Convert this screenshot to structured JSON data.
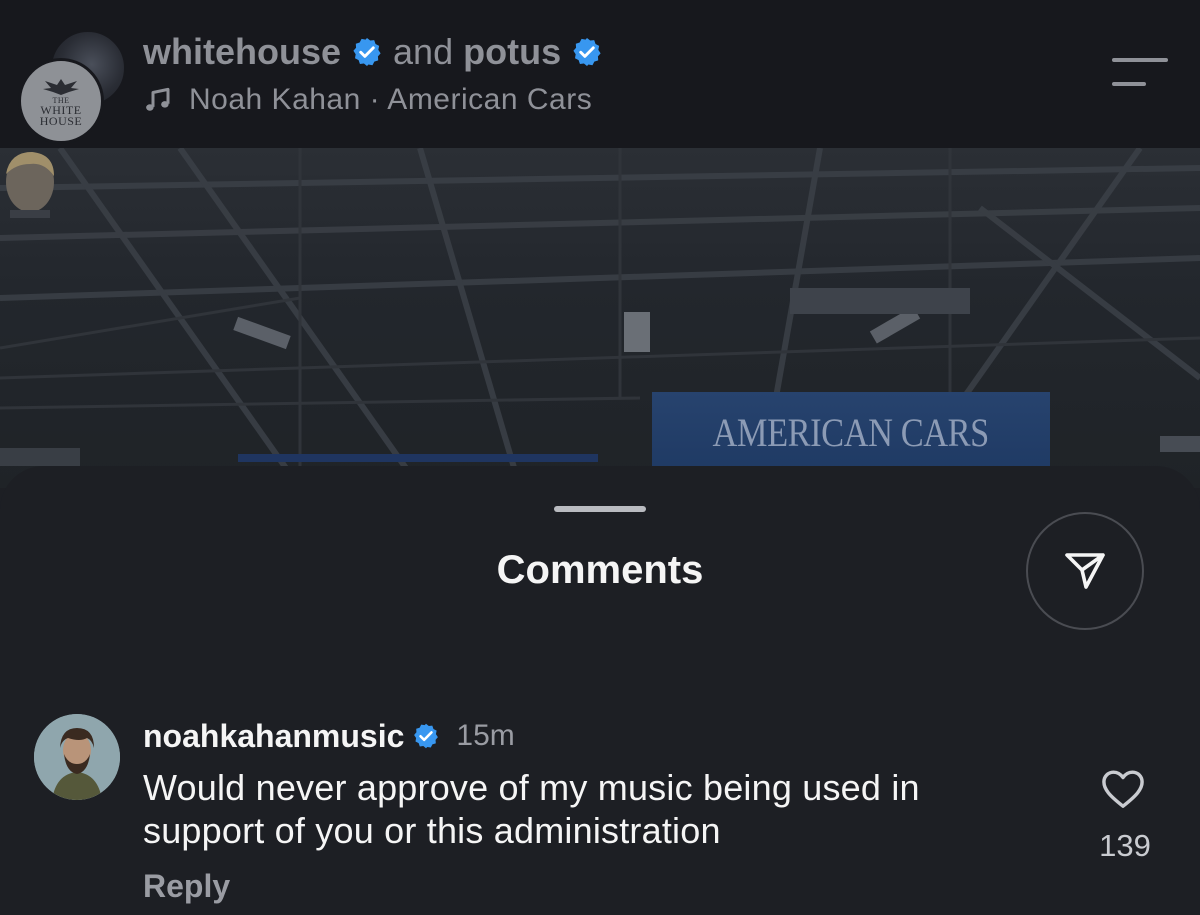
{
  "header": {
    "account_primary": "whitehouse",
    "joiner": "and",
    "account_secondary": "potus",
    "avatar_front_logo": [
      "THE",
      "WHITE",
      "HOUSE"
    ],
    "music": {
      "icon": "music-note-icon",
      "text": "Noah Kahan · American Cars"
    },
    "menu_icon": "hamburger-menu-icon"
  },
  "media": {
    "banner_text": "AMERICAN CARS"
  },
  "comments_sheet": {
    "title": "Comments",
    "share_icon": "paper-plane-icon",
    "comments": [
      {
        "username": "noahkahanmusic",
        "verified": true,
        "time": "15m",
        "text": "Would never approve of my music being used in support of you or this administration",
        "reply_label": "Reply",
        "likes": "139"
      }
    ]
  },
  "colors": {
    "verified_blue": "#3897f0",
    "background": "#1d1f24",
    "topbar": "#17181d",
    "muted_text": "#8f9198",
    "banner_blue": "#27436e"
  }
}
